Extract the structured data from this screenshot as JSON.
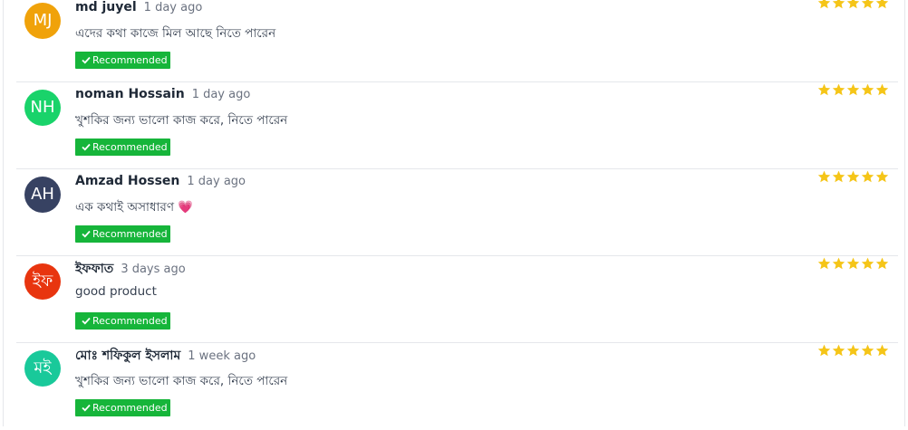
{
  "colors": {
    "badge_green": "#16b53a",
    "star_gold": "#f5c518"
  },
  "reviews": [
    {
      "initials": "MJ",
      "avatar_color": "#f0a20a",
      "name": "md juyel",
      "time": "1 day ago",
      "comment": "এদের কথা কাজে মিল আছে নিতে পারেন",
      "badge": "Recommended",
      "rating": 5
    },
    {
      "initials": "NH",
      "avatar_color": "#19d36a",
      "name": "noman Hossain",
      "time": "1 day ago",
      "comment": "খুশকির জন্য ভালো কাজ করে, নিতে পারেন",
      "badge": "Recommended",
      "rating": 5
    },
    {
      "initials": "AH",
      "avatar_color": "#374262",
      "name": "Amzad Hossen",
      "time": "1 day ago",
      "comment": "এক কথাই অসাধারণ 💗",
      "badge": "Recommended",
      "rating": 5
    },
    {
      "initials": "ইফ",
      "avatar_color": "#e8350f",
      "name": "ইফফাত",
      "time": "3 days ago",
      "comment": "good product",
      "badge": "Recommended",
      "rating": 5
    },
    {
      "initials": "মই",
      "avatar_color": "#19c99a",
      "name": "মোঃ শফিকুল ইসলাম",
      "time": "1 week ago",
      "comment": "খুশকির জন্য ভালো কাজ করে, নিতে পারেন",
      "badge": "Recommended",
      "rating": 5
    }
  ]
}
